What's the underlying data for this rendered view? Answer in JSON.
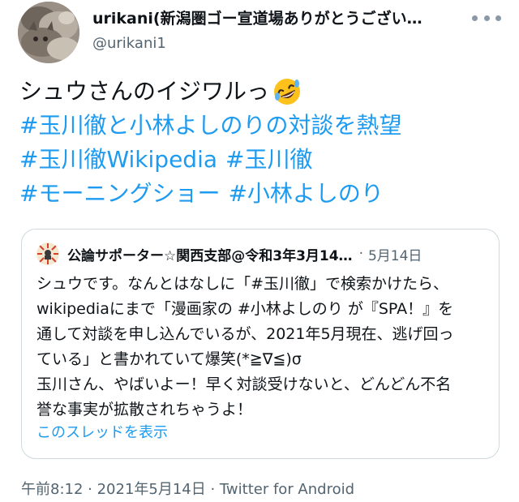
{
  "author": {
    "display_name": "urikani(新潟圏ゴー宣道場ありがとうござい…",
    "handle": "@urikani1",
    "avatar_icon": "cat-photo-avatar"
  },
  "tweet": {
    "line1_text": "シュウさんのイジワルっ",
    "line1_emoji": "rolling-on-floor-laughing-emoji",
    "hashtags": {
      "h1": "#玉川徹と小林よしのりの対談を熱望",
      "h2": "#玉川徹Wikipedia",
      "h3": "#玉川徹",
      "h4": "#モーニングショー",
      "h5": "#小林よしのり"
    }
  },
  "quote": {
    "display_name": "公論サポーター☆関西支部@令和3年3月14…",
    "separator": "·",
    "date": "5月14日",
    "lines": [
      "シュウです。なんとはなしに「#玉川徹」で検索かけたら、",
      "wikipediaにまで「漫画家の #小林よしのり が『SPA！』を",
      "通して対談を申し込んでいるが、2021年5月現在、逃げ回っ",
      "ている」と書かれていて爆笑(*≧∇≦)σ",
      "玉川さん、やばいよー！早く対談受けないと、どんどん不名",
      "誉な事実が拡散されちゃうよ！"
    ],
    "show_thread": "このスレッドを表示"
  },
  "footer": {
    "meta": "午前8:12 · 2021年5月14日 · Twitter for Android"
  },
  "colors": {
    "link": "#1d9bf0",
    "secondary_text": "#536471",
    "border": "#cfd9de"
  }
}
